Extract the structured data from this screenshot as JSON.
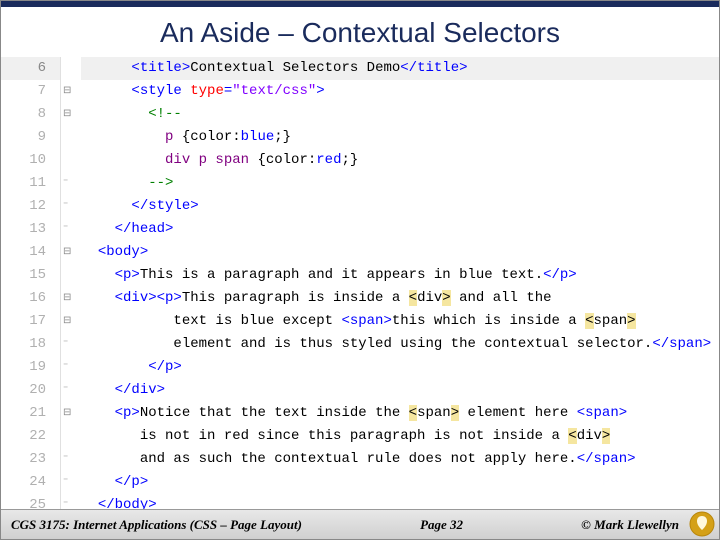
{
  "title": "An Aside – Contextual Selectors",
  "footer": {
    "left": "CGS 3175: Internet Applications (CSS – Page Layout)",
    "mid": "Page 32",
    "right": "© Mark Llewellyn"
  },
  "linesStart": 6,
  "linesEnd": 25,
  "highlightLine": 6,
  "fold": {
    "6": "",
    "7": "⊟",
    "8": "⊟",
    "9": "",
    "10": "",
    "11": "⁻",
    "12": "⁻",
    "13": "⁻",
    "14": "⊟",
    "15": "",
    "16": "⊟",
    "17": "⊟",
    "18": "⁻",
    "19": "⁻",
    "20": "⁻",
    "21": "⊟",
    "22": "",
    "23": "⁻",
    "24": "⁻",
    "25": "⁻"
  },
  "code": {
    "6": {
      "indent": "      ",
      "tokens": [
        {
          "t": "tag",
          "v": "<title>"
        },
        {
          "t": "txt",
          "v": "Contextual Selectors Demo"
        },
        {
          "t": "tag",
          "v": "</title>"
        }
      ]
    },
    "7": {
      "indent": "      ",
      "tokens": [
        {
          "t": "tag",
          "v": "<style "
        },
        {
          "t": "attr",
          "v": "type"
        },
        {
          "t": "tag",
          "v": "="
        },
        {
          "t": "val",
          "v": "\"text/css\""
        },
        {
          "t": "tag",
          "v": ">"
        }
      ]
    },
    "8": {
      "indent": "        ",
      "tokens": [
        {
          "t": "cmt",
          "v": "<!--"
        }
      ]
    },
    "9": {
      "indent": "          ",
      "tokens": [
        {
          "t": "csssel",
          "v": "p "
        },
        {
          "t": "txt",
          "v": "{"
        },
        {
          "t": "cssprop",
          "v": "color:"
        },
        {
          "t": "cssval",
          "v": "blue"
        },
        {
          "t": "txt",
          "v": ";}"
        }
      ]
    },
    "10": {
      "indent": "          ",
      "tokens": [
        {
          "t": "csssel",
          "v": "div p span "
        },
        {
          "t": "txt",
          "v": "{"
        },
        {
          "t": "cssprop",
          "v": "color:"
        },
        {
          "t": "cssval",
          "v": "red"
        },
        {
          "t": "txt",
          "v": ";}"
        }
      ]
    },
    "11": {
      "indent": "        ",
      "tokens": [
        {
          "t": "cmt",
          "v": "-->"
        }
      ]
    },
    "12": {
      "indent": "      ",
      "tokens": [
        {
          "t": "tag",
          "v": "</style>"
        }
      ]
    },
    "13": {
      "indent": "    ",
      "tokens": [
        {
          "t": "tag",
          "v": "</head>"
        }
      ]
    },
    "14": {
      "indent": "  ",
      "tokens": [
        {
          "t": "tag",
          "v": "<body>"
        }
      ]
    },
    "15": {
      "indent": "    ",
      "tokens": [
        {
          "t": "tag",
          "v": "<p>"
        },
        {
          "t": "txt",
          "v": "This is a paragraph and it appears in blue text."
        },
        {
          "t": "tag",
          "v": "</p>"
        }
      ]
    },
    "16": {
      "indent": "    ",
      "tokens": [
        {
          "t": "tag",
          "v": "<div><p>"
        },
        {
          "t": "txt",
          "v": "This paragraph is inside a "
        },
        {
          "t": "ent",
          "v": "&lt;"
        },
        {
          "t": "txt",
          "v": "div"
        },
        {
          "t": "ent",
          "v": "&gt;"
        },
        {
          "t": "txt",
          "v": " and all the"
        }
      ]
    },
    "17": {
      "indent": "           ",
      "tokens": [
        {
          "t": "txt",
          "v": "text is blue except "
        },
        {
          "t": "tag",
          "v": "<span>"
        },
        {
          "t": "txt",
          "v": "this which is inside a "
        },
        {
          "t": "ent",
          "v": "&lt;"
        },
        {
          "t": "txt",
          "v": "span"
        },
        {
          "t": "ent",
          "v": "&gt;"
        }
      ]
    },
    "18": {
      "indent": "           ",
      "tokens": [
        {
          "t": "txt",
          "v": "element and is thus styled using the contextual selector."
        },
        {
          "t": "tag",
          "v": "</span>"
        }
      ]
    },
    "19": {
      "indent": "        ",
      "tokens": [
        {
          "t": "tag",
          "v": "</p>"
        }
      ]
    },
    "20": {
      "indent": "    ",
      "tokens": [
        {
          "t": "tag",
          "v": "</div>"
        }
      ]
    },
    "21": {
      "indent": "    ",
      "tokens": [
        {
          "t": "tag",
          "v": "<p>"
        },
        {
          "t": "txt",
          "v": "Notice that the text inside the "
        },
        {
          "t": "ent",
          "v": "&lt;"
        },
        {
          "t": "txt",
          "v": "span"
        },
        {
          "t": "ent",
          "v": "&gt;"
        },
        {
          "t": "txt",
          "v": " element here "
        },
        {
          "t": "tag",
          "v": "<span>"
        }
      ]
    },
    "22": {
      "indent": "       ",
      "tokens": [
        {
          "t": "txt",
          "v": "is not in red since this paragraph is not inside a "
        },
        {
          "t": "ent",
          "v": "&lt;"
        },
        {
          "t": "txt",
          "v": "div"
        },
        {
          "t": "ent",
          "v": "&gt;"
        }
      ]
    },
    "23": {
      "indent": "       ",
      "tokens": [
        {
          "t": "txt",
          "v": "and as such the contextual rule does not apply here."
        },
        {
          "t": "tag",
          "v": "</span>"
        }
      ]
    },
    "24": {
      "indent": "    ",
      "tokens": [
        {
          "t": "tag",
          "v": "</p>"
        }
      ]
    },
    "25": {
      "indent": "  ",
      "tokens": [
        {
          "t": "tag",
          "v": "</body>"
        }
      ]
    }
  }
}
